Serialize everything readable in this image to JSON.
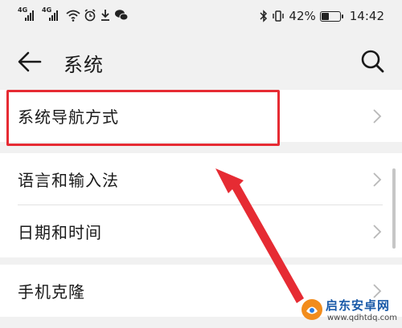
{
  "status_bar": {
    "network_label": "4G",
    "battery_percent_text": "42%",
    "battery_level": 0.42,
    "time": "14:42",
    "icons": [
      "signal-icon",
      "signal-icon",
      "wifi-icon",
      "alarm-icon",
      "download-icon",
      "wechat-icon",
      "bluetooth-icon",
      "vibrate-icon",
      "battery-icon"
    ]
  },
  "header": {
    "title": "系统",
    "back_icon": "back-arrow-icon",
    "search_icon": "search-icon"
  },
  "settings": {
    "groups": [
      {
        "items": [
          {
            "label": "系统导航方式",
            "highlighted": true
          }
        ]
      },
      {
        "items": [
          {
            "label": "语言和输入法"
          },
          {
            "label": "日期和时间"
          }
        ]
      },
      {
        "items": [
          {
            "label": "手机克隆"
          }
        ]
      }
    ]
  },
  "annotation": {
    "highlight_color": "#e62b33",
    "arrow_color": "#e62b33"
  },
  "watermark": {
    "title": "启东安卓网",
    "url": "www.qdhtdq.com"
  }
}
